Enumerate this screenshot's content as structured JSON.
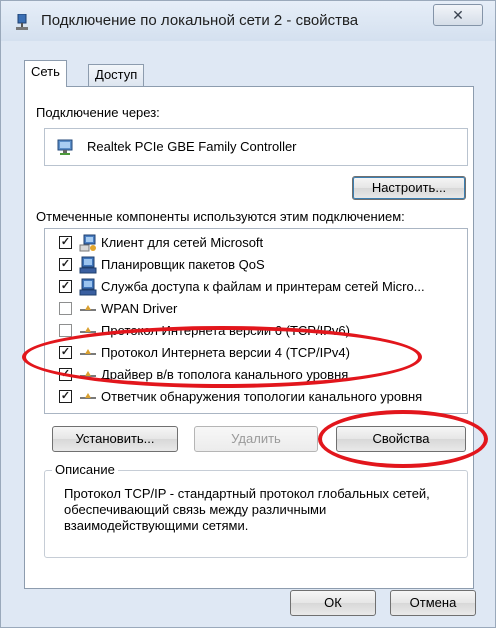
{
  "window": {
    "title": "Подключение по локальной сети 2 - свойства",
    "close_glyph": "✕"
  },
  "tabs": [
    {
      "label": "Сеть",
      "active": true
    },
    {
      "label": "Доступ",
      "active": false
    }
  ],
  "connection": {
    "via_label": "Подключение через:",
    "adapter_name": "Realtek PCIe GBE Family Controller",
    "configure_button": "Настроить..."
  },
  "components": {
    "label": "Отмеченные компоненты используются этим подключением:",
    "items": [
      {
        "label": "Клиент для сетей Microsoft",
        "checked": true,
        "icon": "network-client-icon"
      },
      {
        "label": "Планировщик пакетов QoS",
        "checked": true,
        "icon": "network-service-icon"
      },
      {
        "label": "Служба доступа к файлам и принтерам сетей Micro...",
        "checked": true,
        "icon": "network-service-icon"
      },
      {
        "label": "WPAN Driver",
        "checked": false,
        "icon": "protocol-icon"
      },
      {
        "label": "Протокол Интернета версии 6 (TCP/IPv6)",
        "checked": false,
        "icon": "protocol-icon"
      },
      {
        "label": "Протокол Интернета версии 4 (TCP/IPv4)",
        "checked": true,
        "icon": "protocol-icon"
      },
      {
        "label": "Драйвер в/в тополога канального уровня",
        "checked": true,
        "icon": "protocol-icon"
      },
      {
        "label": "Ответчик обнаружения топологии канального уровня",
        "checked": true,
        "icon": "protocol-icon"
      }
    ]
  },
  "actions": {
    "install": "Установить...",
    "remove": "Удалить",
    "properties": "Свойства"
  },
  "description": {
    "title": "Описание",
    "text": "Протокол TCP/IP - стандартный протокол глобальных сетей, обеспечивающий связь между различными взаимодействующими сетями."
  },
  "footer": {
    "ok": "ОК",
    "cancel": "Отмена"
  },
  "colors": {
    "highlight": "#e2161c",
    "window_frame": "#dfe8f4"
  }
}
